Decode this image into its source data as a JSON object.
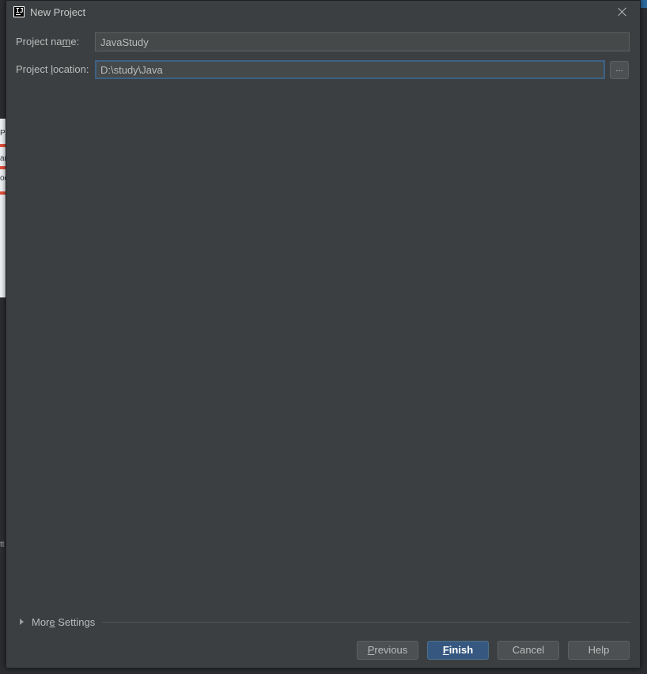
{
  "dialog": {
    "title": "New Project",
    "fields": {
      "project_name": {
        "label_pre": "Project na",
        "label_mnemonic": "m",
        "label_post": "e:",
        "value": "JavaStudy"
      },
      "project_location": {
        "label_pre": "Project ",
        "label_mnemonic": "l",
        "label_post": "ocation:",
        "value": "D:\\study\\Java"
      }
    },
    "browse_label": "...",
    "more_settings": {
      "label_pre": "Mor",
      "label_mnemonic": "e",
      "label_post": " Settings"
    },
    "buttons": {
      "previous": {
        "mnemonic": "P",
        "rest": "revious"
      },
      "finish": {
        "mnemonic": "F",
        "rest": "inish"
      },
      "cancel": "Cancel",
      "help": "Help"
    }
  },
  "background_fragments": [
    "Pr",
    "ar",
    "oc",
    "tt"
  ],
  "colors": {
    "dialog_bg": "#3c3f41",
    "field_bg": "#45494a",
    "focus_border": "#3d6185",
    "default_button": "#365880"
  }
}
